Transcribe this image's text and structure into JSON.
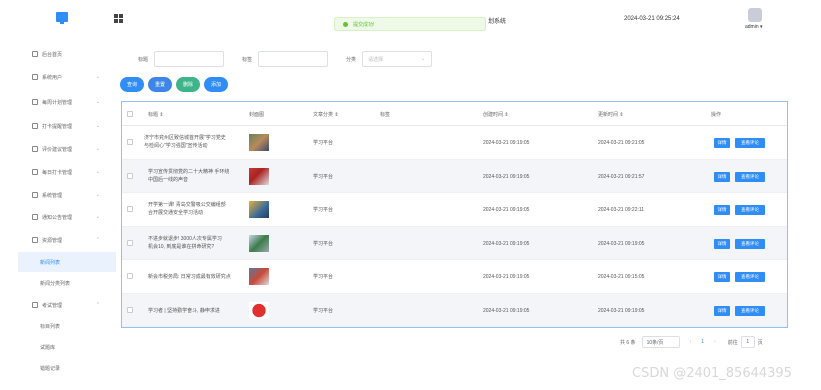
{
  "header": {
    "toast": "提交成功!",
    "system_title": "划系统",
    "time": "2024-03-21 09:25:24",
    "user": "admin ▾"
  },
  "sidebar": {
    "items": [
      {
        "label": "后台首页"
      },
      {
        "label": "系统用户",
        "chevron": "⌄"
      },
      {
        "label": "每周计划管理",
        "chevron": "⌄"
      },
      {
        "label": "打卡提醒管理",
        "chevron": "⌄"
      },
      {
        "label": "评价建议管理",
        "chevron": "⌄"
      },
      {
        "label": "每日打卡管理",
        "chevron": "⌄"
      },
      {
        "label": "系统管理",
        "chevron": "⌄"
      },
      {
        "label": "通知公告管理",
        "chevron": "⌄"
      },
      {
        "label": "资源管理",
        "chevron": "⌃"
      }
    ],
    "sub_items": [
      {
        "label": "新闻列表"
      },
      {
        "label": "新闻分类列表"
      }
    ],
    "exam": {
      "label": "考试管理",
      "chevron": "⌃"
    },
    "exam_sub": [
      {
        "label": "标目列表"
      },
      {
        "label": "试题库"
      },
      {
        "label": "错题记录"
      }
    ]
  },
  "search": {
    "title_label": "标题",
    "tag_label": "标签",
    "category_label": "分类",
    "category_placeholder": "请选择"
  },
  "buttons": {
    "query": "查询",
    "reset": "重置",
    "delete": "删除",
    "add": "添加"
  },
  "table": {
    "headers": [
      "标题 ⇕",
      "封面图",
      "文章分类 ⇕",
      "标签",
      "创建时间 ⇕",
      "更新时间 ⇕",
      "操作"
    ],
    "rows": [
      {
        "title1": "济宁市兖州区致信城首开展\"学习党史",
        "title2": "与检阅心\"学习强国\"宣传活动",
        "category": "学习平台",
        "created": "2024-03-21 09:19:05",
        "updated": "2024-03-21 09:21:05"
      },
      {
        "title1": "学习宣传贯彻党的二十大精神 手环绕",
        "title2": "中国后一线的声音",
        "category": "学习平台",
        "created": "2024-03-21 09:19:05",
        "updated": "2024-03-21 09:21:57"
      },
      {
        "title1": "开学第一课! 青岛交警吸公交编组部",
        "title2": "合开展交通安全学习活动",
        "category": "学习平台",
        "created": "2024-03-21 09:19:05",
        "updated": "2024-03-21 09:22:11"
      },
      {
        "title1": "不进步就退步! 3000人次专属学习",
        "title2": "机会10, 到底是谁在拼命研究?",
        "category": "学习平台",
        "created": "2024-03-21 09:19:05",
        "updated": "2024-03-21 09:19:05"
      },
      {
        "title1": "新会市税务局: 日常习成最有效研究点",
        "title2": "",
        "category": "学习平台",
        "created": "2024-03-21 09:19:05",
        "updated": "2024-03-21 09:15:05"
      },
      {
        "title1": "学习者 | 坚持勤学奋斗, 静申求进",
        "title2": "",
        "category": "学习平台",
        "created": "2024-03-21 09:19:05",
        "updated": "2024-03-21 09:19:05"
      }
    ],
    "detail_label": "详情",
    "review_label": "查看评论"
  },
  "pager": {
    "total": "共 6 条",
    "page_size": "10条/页",
    "prev": "‹",
    "current": "1",
    "next": "›",
    "goto": "前往",
    "goto_value": "1",
    "page_unit": "页"
  },
  "watermark": "CSDN @2401_85644395"
}
